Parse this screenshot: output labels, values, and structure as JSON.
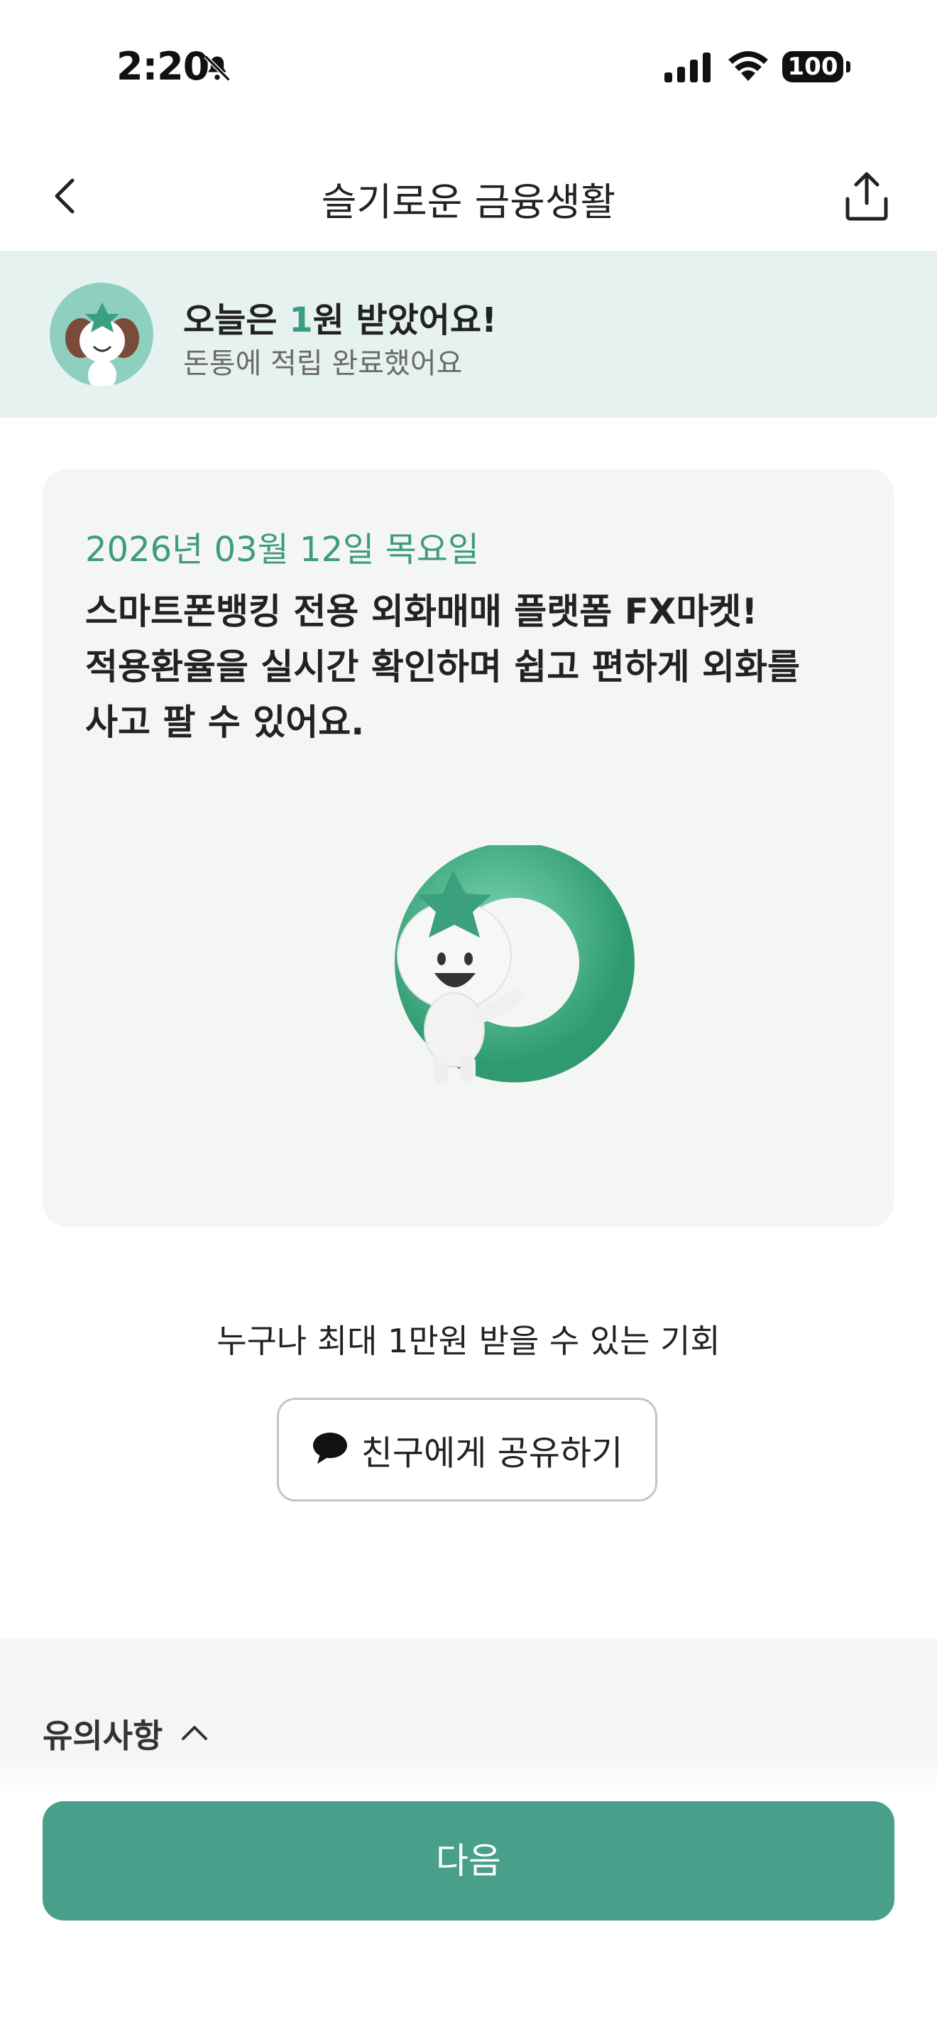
{
  "status_bar": {
    "time": "2:20",
    "battery": "100"
  },
  "nav": {
    "title": "슬기로운 금융생활"
  },
  "banner": {
    "line1_prefix": "오늘은 ",
    "amount": "1",
    "line1_suffix": "원 받았어요!",
    "line2": "돈통에 적립 완료했어요"
  },
  "card": {
    "date": "2026년 03월 12일 목요일",
    "body_lines": [
      "스마트폰뱅킹 전용 외화매매 플랫폼 FX마켓!",
      "적용환율을 실시간 확인하며 쉽고 편하게 외화를",
      "사고 팔 수 있어요."
    ]
  },
  "promo_text": "누구나 최대 1만원 받을 수 있는 기회",
  "share_button": {
    "label": "친구에게 공유하기"
  },
  "notice": {
    "label": "유의사항"
  },
  "next_button": {
    "label": "다음"
  },
  "colors": {
    "accent": "#49a08a",
    "banner_bg": "#e6f2ef",
    "card_bg": "#f4f6f5",
    "date_text": "#3e9a80"
  }
}
